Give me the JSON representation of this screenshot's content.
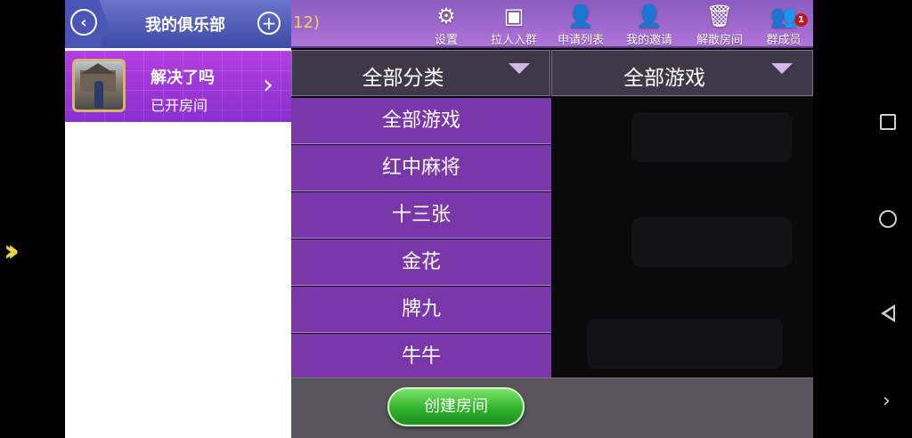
{
  "sidebar": {
    "title": "我的俱乐部",
    "club": {
      "name": "解决了吗",
      "status": "已开房间"
    }
  },
  "topbar": {
    "room_count": "12)",
    "tools": [
      {
        "label": "设置",
        "icon": "gear-icon"
      },
      {
        "label": "拉人入群",
        "icon": "invite-icon"
      },
      {
        "label": "申请列表",
        "icon": "user-add-icon"
      },
      {
        "label": "我的邀请",
        "icon": "user-add-icon"
      },
      {
        "label": "解散房间",
        "icon": "trash-icon"
      },
      {
        "label": "群成员",
        "icon": "group-icon"
      }
    ],
    "member_badge": "1"
  },
  "filters": {
    "category": "全部分类",
    "game": "全部游戏"
  },
  "dropdown": {
    "options": [
      "全部游戏",
      "红中麻将",
      "十三张",
      "金花",
      "牌九",
      "牛牛"
    ]
  },
  "bottombar": {
    "create_button": "创建房间"
  },
  "colors": {
    "accent": "#7a37a9",
    "topbar": "#8a5cc0",
    "create_button": "#2fb32c"
  }
}
